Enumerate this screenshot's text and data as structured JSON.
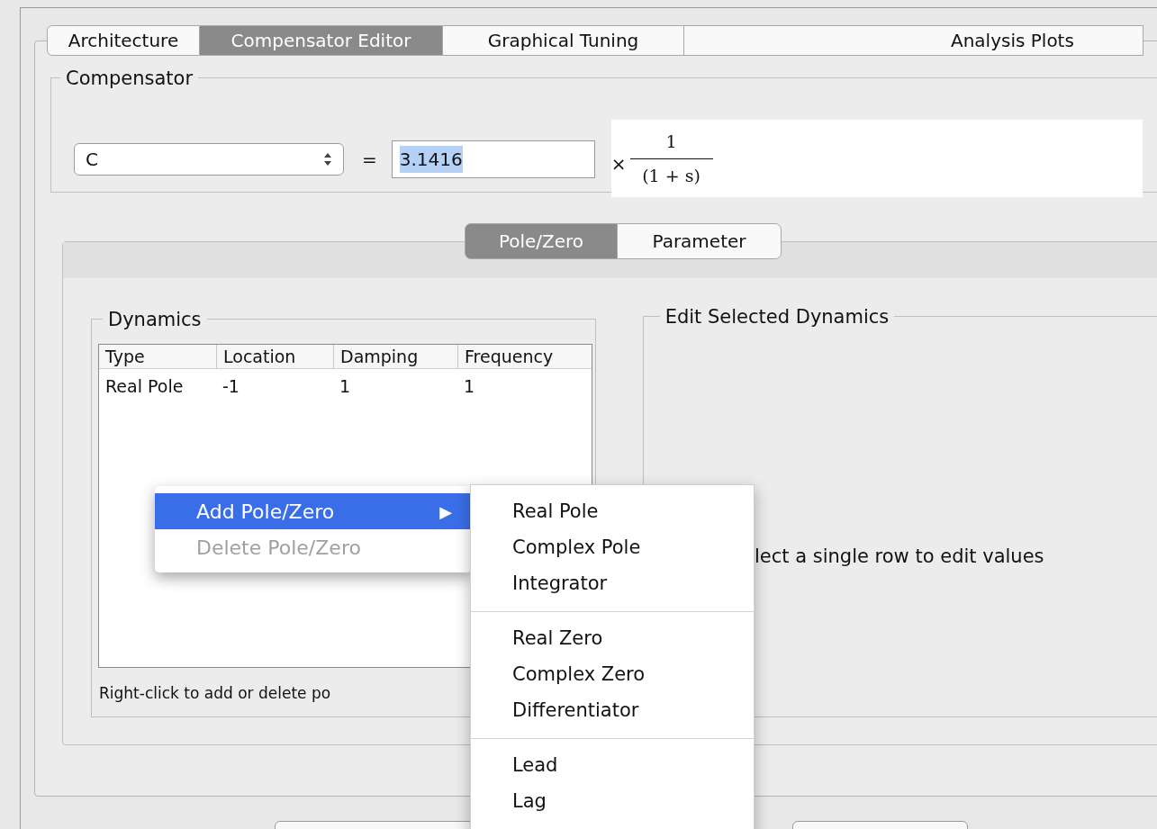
{
  "tabs": [
    {
      "label": "Architecture",
      "selected": false
    },
    {
      "label": "Compensator Editor",
      "selected": true
    },
    {
      "label": "Graphical Tuning",
      "selected": false
    },
    {
      "label": "Analysis Plots",
      "selected": false
    }
  ],
  "compensator": {
    "title": "Compensator",
    "name": "C",
    "equals": "=",
    "gain": "3.1416",
    "times": "×",
    "numerator": "1",
    "denominator": "(1 + s)"
  },
  "subtabs": [
    {
      "label": "Pole/Zero",
      "selected": true
    },
    {
      "label": "Parameter",
      "selected": false
    }
  ],
  "dynamics": {
    "title": "Dynamics",
    "columns": [
      "Type",
      "Location",
      "Damping",
      "Frequency"
    ],
    "rows": [
      [
        "Real Pole",
        "-1",
        "1",
        "1"
      ]
    ],
    "hint": "Right-click to add or delete po"
  },
  "edit_panel": {
    "title": "Edit Selected Dynamics",
    "message": "lect a single row to edit values"
  },
  "context_menu": [
    {
      "label": "Add Pole/Zero",
      "arrow": "▶",
      "selected": true,
      "disabled": false
    },
    {
      "label": "Delete Pole/Zero",
      "selected": false,
      "disabled": true
    }
  ],
  "submenu": [
    [
      "Real Pole",
      "Complex Pole",
      "Integrator"
    ],
    [
      "Real Zero",
      "Complex Zero",
      "Differentiator"
    ],
    [
      "Lead",
      "Lag"
    ]
  ]
}
